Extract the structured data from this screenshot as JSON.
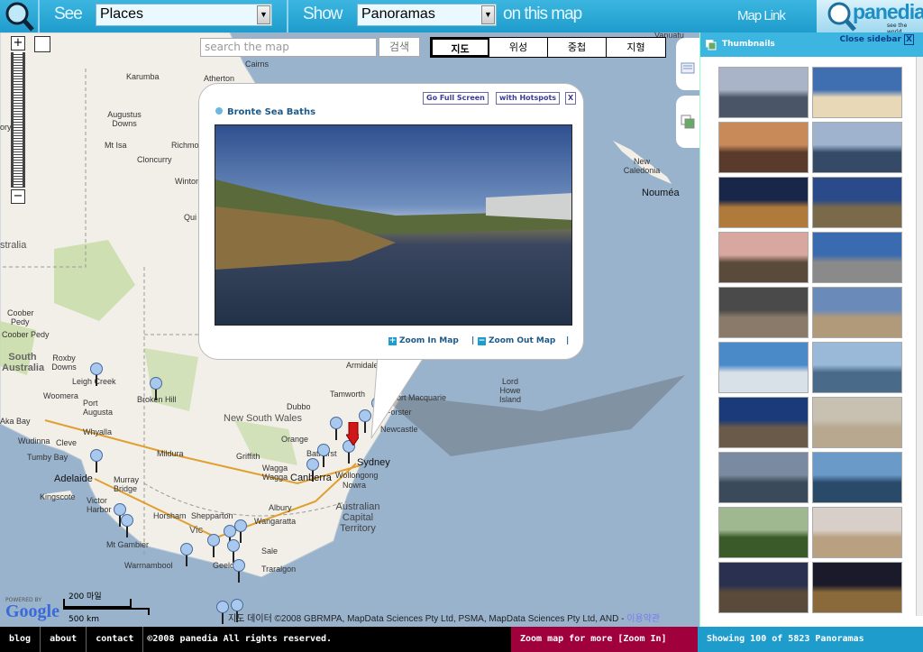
{
  "header": {
    "see_label": "See",
    "see_value": "Places",
    "show_label": "Show",
    "show_value": "Panoramas",
    "suffix": "on this map",
    "map_link": "Map Link",
    "logo_text": "panedia",
    "logo_tagline": "see the world"
  },
  "map": {
    "search_placeholder": "search the map",
    "search_button": "검색",
    "map_types": [
      {
        "label": "지도",
        "active": true
      },
      {
        "label": "위성",
        "active": false
      },
      {
        "label": "중첩",
        "active": false
      },
      {
        "label": "지형",
        "active": false
      }
    ],
    "places": [
      "Karumba",
      "Cairns",
      "Atherton",
      "Augustus Downs",
      "Mt Isa",
      "Richmond",
      "Cloncurry",
      "Winton",
      "Qui",
      "stralia",
      "Coober Pedy",
      "South Australia",
      "Roxby Downs",
      "Leigh Creek",
      "Woomera",
      "Port Augusta",
      "Broken Hill",
      "Whyalla",
      "Cleve",
      "Wudinna",
      "Tumby Bay",
      "Adelaide",
      "Murray Bridge",
      "Kingscote",
      "Victor Harbor",
      "Mt Gambier",
      "Warrnambool",
      "Horsham",
      "Shepparton",
      "Wangaratta",
      "Albury",
      "Wagga Wagga",
      "Griffith",
      "Mildura",
      "New South Wales",
      "Dubbo",
      "Orange",
      "Bathurst",
      "Canberra",
      "Sydney",
      "Newcastle",
      "Tamworth",
      "Armidale",
      "Port Macquarie",
      "Forster",
      "Nowra",
      "Australian Capital Territory",
      "Lord Howe Island",
      "New Caledonia",
      "Nouméa",
      "Vanuatu",
      "Vic",
      "Geelong",
      "Sale",
      "Traralgon",
      "Wollongong",
      "Coober",
      "Pedy",
      "ory",
      "Aka Bay"
    ],
    "scale_top": "200 마일",
    "scale_bottom": "500 km",
    "powered_by": "POWERED BY",
    "google": "Google",
    "copyright": "지도 데이터 ©2008 GBRMPA, MapData Sciences Pty Ltd, PSMA, MapData Sciences Pty Ltd, AND - ",
    "terms": "이용약관"
  },
  "popup": {
    "title": "Bronte Sea Baths",
    "full_screen": "Go Full Screen",
    "hotspots": "with Hotspots",
    "close": "X",
    "zoom_in": "Zoom In Map",
    "zoom_out": "Zoom Out Map",
    "sep": "|"
  },
  "sidebar": {
    "title": "Thumbnails",
    "close": "Close sidebar",
    "thumbnails": [
      [
        "#a9b4c8",
        "#4a5568"
      ],
      [
        "#3f6fb0",
        "#e8d8b8"
      ],
      [
        "#c98a5a",
        "#5a3a2a"
      ],
      [
        "#9fb3cf",
        "#344a66"
      ],
      [
        "#18264a",
        "#b07a3a"
      ],
      [
        "#2a4a8a",
        "#7a6a4a"
      ],
      [
        "#d8a8a0",
        "#5a4a3a"
      ],
      [
        "#3a6ab0",
        "#8a8a8a"
      ],
      [
        "#4a4a4a",
        "#8a7a6a"
      ],
      [
        "#6a8aba",
        "#b09a7a"
      ],
      [
        "#4a8ac8",
        "#d8e0e8"
      ],
      [
        "#9ab8d8",
        "#4a6a8a"
      ],
      [
        "#1a3a7a",
        "#6a5a4a"
      ],
      [
        "#c8c0b0",
        "#b8a890"
      ],
      [
        "#7a8aa0",
        "#3a4a5a"
      ],
      [
        "#6a9ac8",
        "#2a4a6a"
      ],
      [
        "#a0b890",
        "#3a5a2a"
      ],
      [
        "#d8d0c8",
        "#b8a080"
      ],
      [
        "#2a3050",
        "#5a4a3a"
      ],
      [
        "#1a1a2a",
        "#8a6a3a"
      ]
    ]
  },
  "footer": {
    "links": [
      "blog",
      "about",
      "contact"
    ],
    "copyright": "©2008 panedia All rights reserved.",
    "zoom_more": "Zoom map for more  [Zoom In]",
    "showing": "Showing 100 of 5823 Panoramas"
  },
  "colors": {
    "header": "#1e9ccc",
    "sea": "#99b3cc",
    "land": "#f2efe9",
    "park": "#c4dca4",
    "zoom_bar": "#a0003c"
  }
}
